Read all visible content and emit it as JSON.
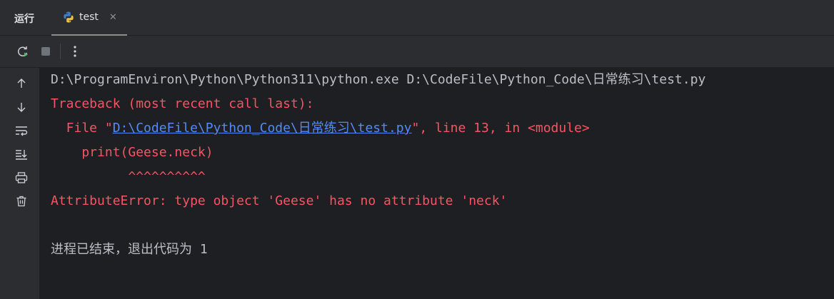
{
  "header": {
    "run_label": "运行",
    "tab_label": "test"
  },
  "icons": {
    "tab": "python-file-icon",
    "toolbar": [
      "rerun-icon",
      "stop-icon",
      "more-options-icon"
    ],
    "sidebar": [
      "scroll-up-icon",
      "scroll-down-icon",
      "soft-wrap-icon",
      "scroll-to-end-icon",
      "print-icon",
      "clear-all-icon"
    ]
  },
  "colors": {
    "background": "#1e1f22",
    "panel": "#2b2d30",
    "text": "#bcbec4",
    "error": "#f75464",
    "link": "#548af7"
  },
  "console": {
    "command": "D:\\ProgramEnviron\\Python\\Python311\\python.exe D:\\CodeFile\\Python_Code\\日常练习\\test.py",
    "traceback": "Traceback (most recent call last):",
    "file_prefix": "  File \"",
    "file_link": "D:\\CodeFile\\Python_Code\\日常练习\\test.py",
    "file_suffix": "\", line 13, in <module>",
    "code_line": "    print(Geese.neck)",
    "caret_line": "          ^^^^^^^^^^",
    "error_message": "AttributeError: type object 'Geese' has no attribute 'neck'",
    "exit_message": "进程已结束，退出代码为 1"
  }
}
